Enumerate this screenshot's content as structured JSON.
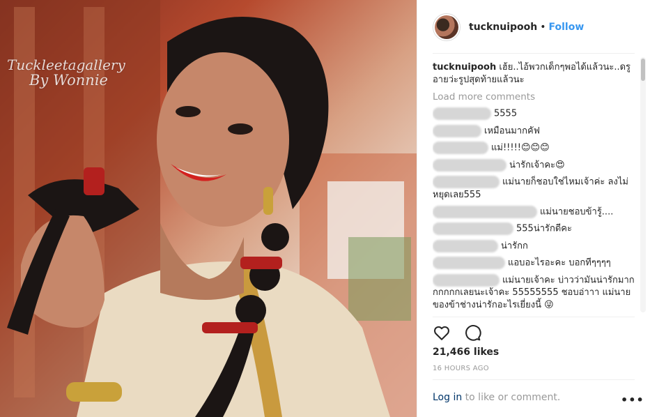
{
  "photo": {
    "watermark_line1": "Tuckleetagallery",
    "watermark_line2": "By Wonnie"
  },
  "header": {
    "username": "tucknuipooh",
    "separator": "•",
    "follow_label": "Follow"
  },
  "caption": {
    "username": "tucknuipooh",
    "text": "เฮ้ย..ไอ้พวกเด็กๆพอได้แล้วนะ..ดรูอายว่ะรูปสุดท้ายแล้วนะ"
  },
  "load_more_label": "Load more comments",
  "comments": [
    {
      "text": "5555"
    },
    {
      "text": "เหมือนมากคัฟ"
    },
    {
      "text": "แม่!!!!!😊😊😊"
    },
    {
      "text": "น่ารักเจ้าคะ😍"
    },
    {
      "text": "แม่นายก็ชอบใช่ไหมเจ้าค่ะ ลงไม่หยุดเลย555"
    },
    {
      "text": "แม่นายชอบข้ารู้...."
    },
    {
      "text": "555น่ารักดีคะ"
    },
    {
      "text": "น่ารักก"
    },
    {
      "text": "แอบอะไรอะคะ บอกทีๆๆๆๆ"
    },
    {
      "text": "แม่นายเจ้าคะ บ่าวว่ามันน่ารักมากกกกกกเลยนะเจ้าคะ 55555555 ชอบอ่าาา แม่นายของข้าช่างน่ารักอะไรเยี่ยงนี้ 😜"
    }
  ],
  "likes_text": "21,466 likes",
  "timestamp": "16 HOURS AGO",
  "footer": {
    "login_label": "Log in",
    "rest": " to like or comment.",
    "more_label": "•••"
  },
  "colors": {
    "accent": "#3897f0",
    "muted": "#999999",
    "text": "#262626"
  },
  "icons": [
    "heart-icon",
    "comment-icon",
    "more-options-icon"
  ]
}
